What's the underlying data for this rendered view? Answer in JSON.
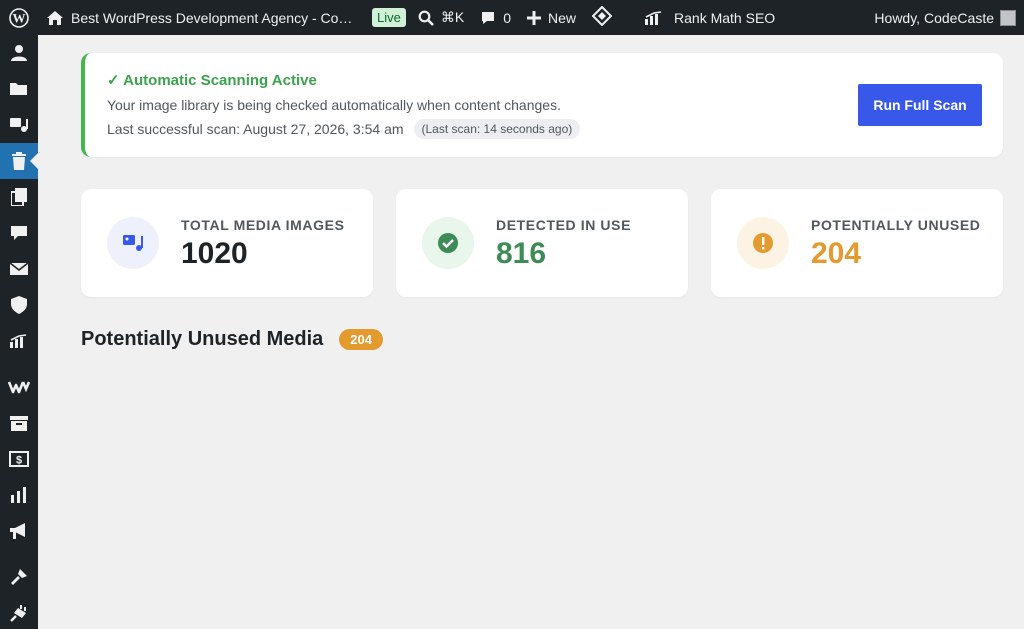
{
  "adminbar": {
    "site_title": "Best WordPress Development Agency - Code…",
    "live_label": "Live",
    "shortcut_label": "⌘K",
    "comments_count": "0",
    "new_label": "New",
    "seo_label": "Rank Math SEO",
    "greeting": "Howdy, CodeCaste"
  },
  "sidebar": {
    "items": [
      {
        "icon": "user-icon"
      },
      {
        "icon": "folder-icon"
      },
      {
        "icon": "media-icon"
      },
      {
        "icon": "trash-icon",
        "active": true
      },
      {
        "icon": "pages-icon"
      },
      {
        "icon": "comments-icon"
      },
      {
        "icon": "mail-icon"
      },
      {
        "icon": "shield-icon"
      },
      {
        "icon": "rank-math-icon"
      },
      {
        "icon": "woo-icon"
      },
      {
        "icon": "archive-icon"
      },
      {
        "icon": "dollar-icon"
      },
      {
        "icon": "analytics-icon"
      },
      {
        "icon": "megaphone-icon"
      },
      {
        "icon": "appearance-icon"
      },
      {
        "icon": "plugins-icon"
      }
    ]
  },
  "notice": {
    "title": "✓ Automatic Scanning Active",
    "description": "Your image library is being checked automatically when content changes.",
    "last_scan": "Last successful scan: August 27, 2026, 3:54 am",
    "last_scan_ago": "(Last scan: 14 seconds ago)",
    "button_label": "Run Full Scan"
  },
  "stats": [
    {
      "label": "TOTAL MEDIA IMAGES",
      "value": "1020",
      "color": "#1d2327",
      "icon": "media-icon"
    },
    {
      "label": "DETECTED IN USE",
      "value": "816",
      "color": "#3d8b55",
      "icon": "check-circle-icon"
    },
    {
      "label": "POTENTIALLY UNUSED",
      "value": "204",
      "color": "#e39a2e",
      "icon": "warning-icon"
    }
  ],
  "section": {
    "title": "Potentially Unused Media",
    "count": "204"
  },
  "colors": {
    "accent": "#3858e9",
    "success": "#46b450",
    "warning": "#e39a2e"
  }
}
